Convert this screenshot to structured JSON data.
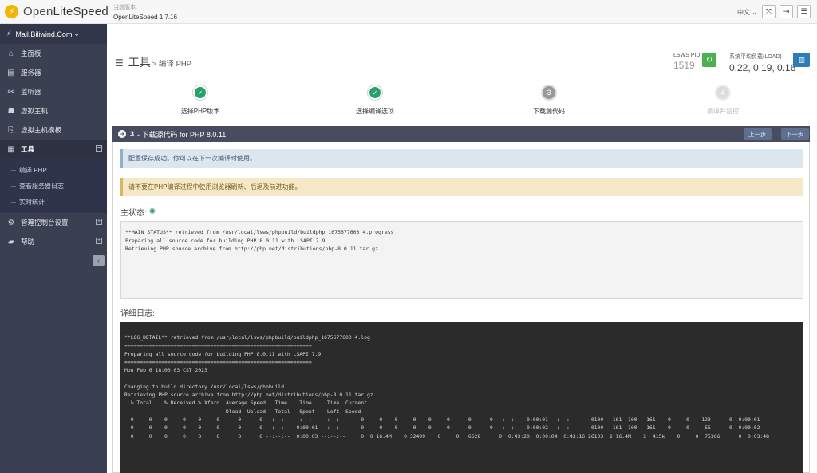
{
  "topbar": {
    "logo_text_light": "Open",
    "logo_text_bold": "LiteSpeed",
    "version_label": "当前版本:",
    "version_value": "OpenLiteSpeed 1.7.16",
    "language": "中文",
    "icons": [
      "fullscreen-icon",
      "logout-icon",
      "menu-icon"
    ]
  },
  "sidebar": {
    "site_name": "Mail.Biliwind.Com",
    "items": [
      {
        "label": "主面板",
        "icon": "home-icon"
      },
      {
        "label": "服务器",
        "icon": "server-icon"
      },
      {
        "label": "监听器",
        "icon": "listener-icon"
      },
      {
        "label": "虚拟主机",
        "icon": "vhost-icon"
      },
      {
        "label": "虚拟主机模板",
        "icon": "template-icon"
      },
      {
        "label": "工具",
        "icon": "tools-icon"
      },
      {
        "label": "管理控制台设置",
        "icon": "gear-icon"
      },
      {
        "label": "帮助",
        "icon": "book-icon"
      }
    ],
    "tools_sub": [
      "编译 PHP",
      "查看服务器日志",
      "实时统计"
    ]
  },
  "header": {
    "title": "工具",
    "subtitle": "> 编译 PHP",
    "pid_label": "LSWS PID",
    "pid_value": "1519",
    "load_label": "系统平均负载(LOAD)",
    "load_value": "0.22, 0.19, 0.16"
  },
  "wizard": {
    "steps": [
      {
        "label": "选择PHP版本",
        "state": "done",
        "mark": "✓"
      },
      {
        "label": "选择编译选项",
        "state": "done",
        "mark": "✓"
      },
      {
        "label": "下载源代码",
        "state": "current",
        "mark": "3"
      },
      {
        "label": "编译并监控",
        "state": "todo",
        "mark": "4"
      }
    ]
  },
  "panel": {
    "step_num": "3",
    "title": "- 下载源代码 for PHP 8.0.11",
    "prev_label": "上一步",
    "next_label": "下一步",
    "info_msg": "配置保存成功。你可以在下一次编译时使用。",
    "warn_msg": "请不要在PHP编译过程中使用浏览器刷新、后退及前进功能。",
    "status_title": "主状态:",
    "status_text": "**MAIN_STATUS** retrieved from /usr/local/lsws/phpbuild/buildphp_1675677603.4.progress\nPreparing all source code for building PHP 8.0.11 with LSAPI 7.9\nRetrieving PHP source archive from http://php.net/distributions/php-8.0.11.tar.gz",
    "log_title": "详细日志:",
    "log_text": "**LOG_DETAIL** retrieved from /usr/local/lsws/phpbuild/buildphp_1675677603.4.log\n=============================================================\nPreparing all source code for building PHP 8.0.11 with LSAPI 7.9\n=============================================================\nMon Feb 6 18:00:03 CST 2023\n\nChanging to build directory /usr/local/lsws/phpbuild\nRetrieving PHP source archive from http://php.net/distributions/php-8.0.11.tar.gz\n  % Total    % Received % Xferd  Average Speed   Time    Time     Time  Current\n                                 Dload  Upload   Total   Spent    Left  Speed\n  0     0    0     0    0     0      0      0 --:--:-- --:--:-- --:--:--     0     0    0     0    0     0      0      0 --:--:--  0:00:01 --:--:--     0100   161  100   161    0     0    123      0  0:00:01\n  0     0    0     0    0     0      0      0 --:--:--  0:00:01 --:--:--     0     0    0     0    0     0      0      0 --:--:--  0:00:02 --:--:--     0100   161  100   161    0     0     55      0  0:00:02\n  0     0    0     0    0     0      0      0 --:--:--  0:00:03 --:--:--     0  0 16.4M    0 32499    0     0   6628      0  0:43:20  0:00:04  0:43:16 26103  2 16.4M    2  415k    0     0  75366      0  0:03:48"
  }
}
